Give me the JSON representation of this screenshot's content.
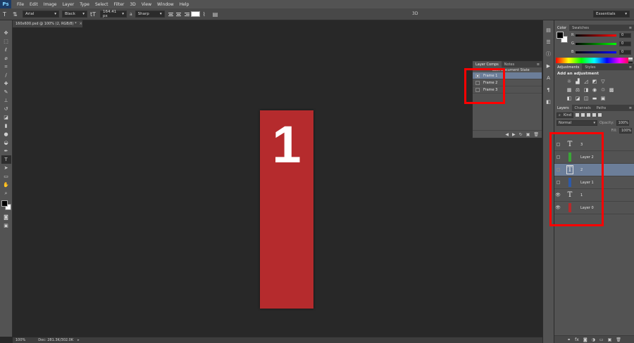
{
  "menubar": {
    "logo": "Ps",
    "items": [
      "File",
      "Edit",
      "Image",
      "Layer",
      "Type",
      "Select",
      "Filter",
      "3D",
      "View",
      "Window",
      "Help"
    ]
  },
  "options": {
    "font_family": "Arial",
    "font_style": "Black",
    "font_size": "164.41 px",
    "aa_label": "a",
    "aa_mode": "Sharp",
    "color_swatch": "#ffffff",
    "label_3d": "3D",
    "workspace": "Essentials"
  },
  "document": {
    "tab_title": "160x600.psd @ 100% (2, RGB/8) *",
    "artboard_text": "1",
    "artboard_color": "#b52b2d"
  },
  "status": {
    "zoom": "100%",
    "doc_info": "Doc: 281.3K/302.0K"
  },
  "layer_comps": {
    "tabs": [
      "Layer Comps",
      "Notes"
    ],
    "last_state": "Last Document State",
    "comps": [
      "Frame 1",
      "Frame 2",
      "Frame 3"
    ]
  },
  "color_panel": {
    "tabs": [
      "Color",
      "Swatches"
    ],
    "channels": [
      {
        "label": "R",
        "value": "0"
      },
      {
        "label": "G",
        "value": "0"
      },
      {
        "label": "B",
        "value": "0"
      }
    ]
  },
  "adjust_panel": {
    "tabs": [
      "Adjustments",
      "Styles"
    ],
    "title": "Add an adjustment"
  },
  "layers_panel": {
    "tabs": [
      "Layers",
      "Channels",
      "Paths"
    ],
    "kind": "Kind",
    "blend_mode": "Normal",
    "opacity_label": "Opacity:",
    "opacity_value": "100%",
    "fill_label": "Fill:",
    "fill_value": "100%",
    "layers": [
      {
        "name": "3",
        "type": "text",
        "visible": false,
        "selected": false
      },
      {
        "name": "Layer 2",
        "type": "color",
        "color": "#3aa637",
        "visible": false,
        "selected": false
      },
      {
        "name": "2",
        "type": "text",
        "visible": false,
        "selected": true
      },
      {
        "name": "Layer 1",
        "type": "color",
        "color": "#2e5aa8",
        "visible": false,
        "selected": false
      },
      {
        "name": "1",
        "type": "text",
        "visible": true,
        "selected": false
      },
      {
        "name": "Layer 0",
        "type": "color",
        "color": "#b52b2d",
        "visible": true,
        "selected": false
      }
    ]
  },
  "colors": {
    "highlight": "#ff0000",
    "selection": "#6c7e99"
  }
}
